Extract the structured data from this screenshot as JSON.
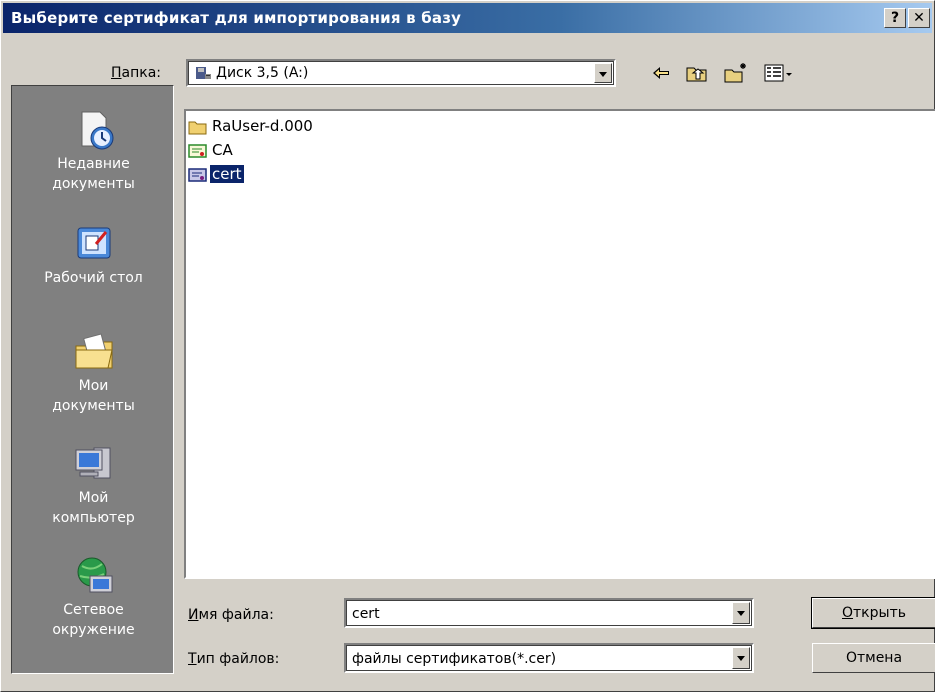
{
  "title": "Выберите сертификат для импортирования в базу",
  "title_buttons": {
    "help": "?",
    "close": "✕"
  },
  "folder": {
    "label_u": "П",
    "label_rest": "апка:",
    "value": "Диск 3,5 (A:)"
  },
  "toolbar": {
    "back_icon": "back-arrow-icon",
    "up_icon": "folder-up-icon",
    "new_icon": "new-folder-icon",
    "view_icon": "view-menu-icon"
  },
  "places": {
    "recent_1": "Недавние",
    "recent_2": "документы",
    "desktop": "Рабочий стол",
    "mydocs_1": "Мои",
    "mydocs_2": "документы",
    "computer_1": "Мой",
    "computer_2": "компьютер",
    "network_1": "Сетевое",
    "network_2": "окружение"
  },
  "files": [
    {
      "name": "RaUser-d.000",
      "icon": "folder-icon"
    },
    {
      "name": "CA",
      "icon": "certificate-icon"
    },
    {
      "name": "cert",
      "icon": "certificate-icon",
      "selected": true
    }
  ],
  "filename": {
    "label_u": "И",
    "label_rest": "мя файла:",
    "value": "cert"
  },
  "filetype": {
    "label_u": "Т",
    "label_rest": "ип файлов:",
    "value": "файлы сертификатов(*.cer)"
  },
  "buttons": {
    "open_u": "О",
    "open_rest": "ткрыть",
    "cancel": "Отмена"
  },
  "colors": {
    "titlebar": "#0a246a",
    "selection": "#0a246a",
    "face": "#d4d0c8",
    "places_bg": "#808080"
  }
}
